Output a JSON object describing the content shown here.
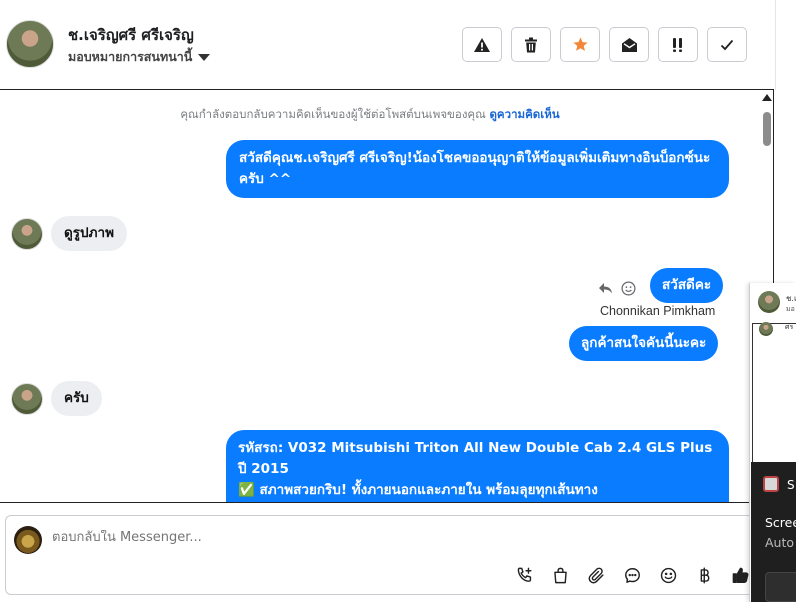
{
  "header": {
    "contact_name": "ช.เจริญศรี ศรีเจริญ",
    "assign_label": "มอบหมายการสนทนานี้",
    "actions": [
      {
        "icon": "warning-icon",
        "glyph": "⚠"
      },
      {
        "icon": "trash-icon",
        "glyph": "🗑"
      },
      {
        "icon": "star-icon",
        "glyph": "★"
      },
      {
        "icon": "open-envelope-icon",
        "glyph": "✉"
      },
      {
        "icon": "priority-icon",
        "glyph": "!!"
      },
      {
        "icon": "check-icon",
        "glyph": "✓"
      }
    ]
  },
  "thread": {
    "notice_text": "คุณกำลังตอบกลับความคิดเห็นของผู้ใช้ต่อโพสต์บนเพจของคุณ",
    "notice_link": "ดูความคิดเห็น",
    "messages": {
      "m1": "สวัสดีคุณช.เจริญศรี ศรีเจริญ!น้องโชคขออนุญาติให้ข้อมูลเพิ่มเติมทางอินบ็อกซ์นะครับ ^^",
      "m2": "ดูรูปภาพ",
      "m3": "สวัสดีคะ",
      "m3_sender": "Chonnikan Pimkham",
      "m4": "ลูกค้าสนใจคันนี้นะคะ",
      "m5": "ครับ",
      "m6_line1": "รหัสรถ: V032 Mitsubishi Triton All New Double Cab 2.4 GLS Plus ปี 2015",
      "m6_line2": "✅ สภาพสวยกริบ! ทั้งภายนอกและภายใน พร้อมลุยทุกเส้นทาง"
    }
  },
  "composer": {
    "placeholder": "ตอบกลับใน Messenger...",
    "tools": [
      "phone-add-icon",
      "shopping-bag-icon",
      "paperclip-icon",
      "chat-bubble-icon",
      "emoji-icon",
      "baht-icon",
      "thumbs-up-icon"
    ]
  },
  "side_panel": {
    "name": "ช.เ",
    "sub": "มอ",
    "mini_text": "ศร"
  },
  "toast": {
    "title": "S",
    "line1": "Scree",
    "line2": "Auto"
  },
  "colors": {
    "accent_blue": "#0a7cff",
    "star_orange": "#f2873a",
    "incoming_bubble": "#eceef1"
  }
}
